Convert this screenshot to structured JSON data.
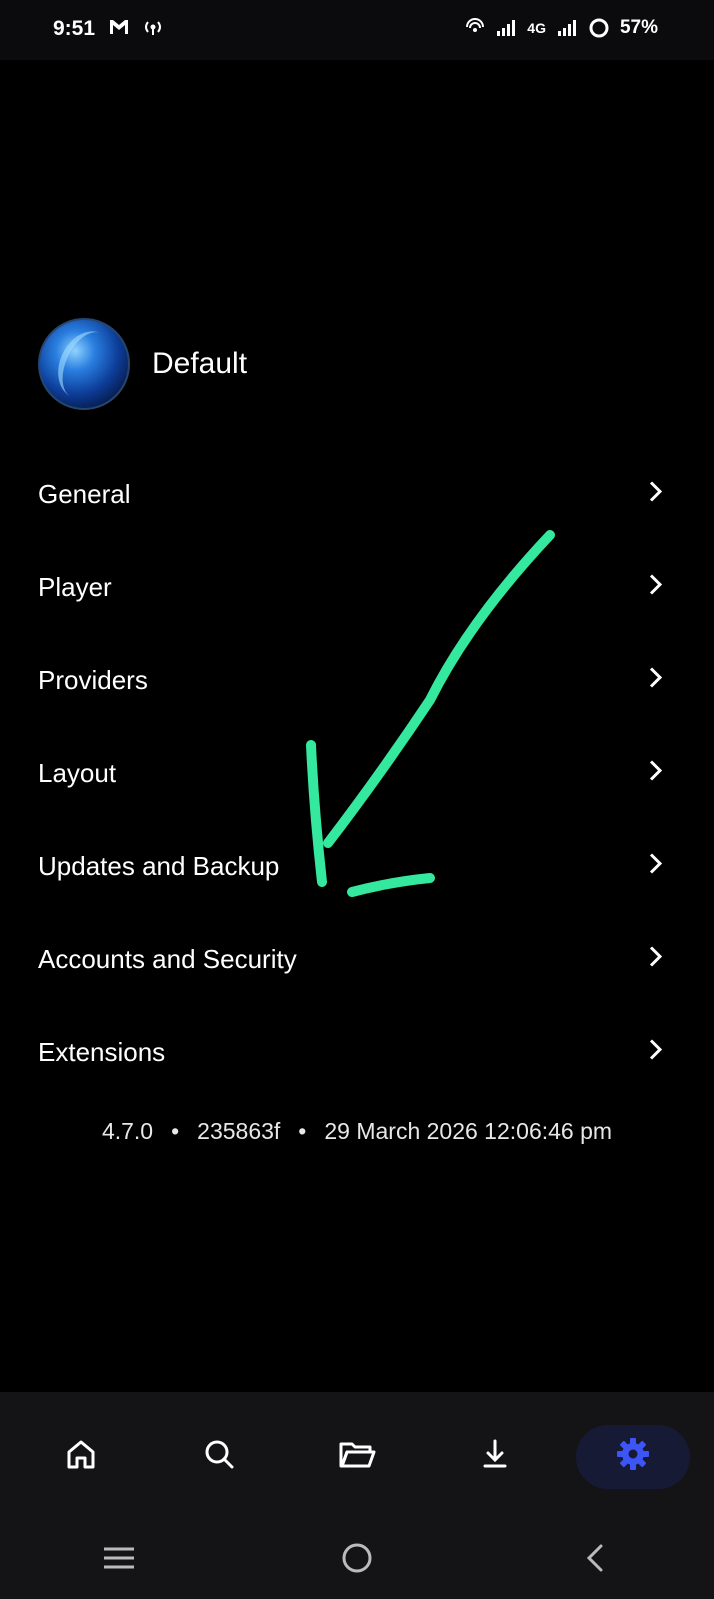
{
  "status_bar": {
    "time": "9:51",
    "network": "4G",
    "battery": "57%",
    "icons": [
      "gmail-icon",
      "hotspot-icon",
      "wifi-calling-icon",
      "signal-icon",
      "signal-icon-2",
      "battery-saver-icon"
    ]
  },
  "profile": {
    "name": "Default"
  },
  "menu": {
    "items": [
      {
        "label": "General"
      },
      {
        "label": "Player"
      },
      {
        "label": "Providers"
      },
      {
        "label": "Layout"
      },
      {
        "label": "Updates and Backup"
      },
      {
        "label": "Accounts and Security"
      },
      {
        "label": "Extensions"
      }
    ]
  },
  "version_info": {
    "version": "4.7.0",
    "commit": "235863f",
    "build_date": "29 March 2026 12:06:46 pm"
  },
  "bottom_nav": {
    "items": [
      "home-icon",
      "search-icon",
      "folder-icon",
      "download-icon",
      "settings-icon"
    ],
    "active": "settings-icon",
    "active_color": "#3d55f5"
  },
  "annotation": {
    "color": "#34e89e"
  }
}
